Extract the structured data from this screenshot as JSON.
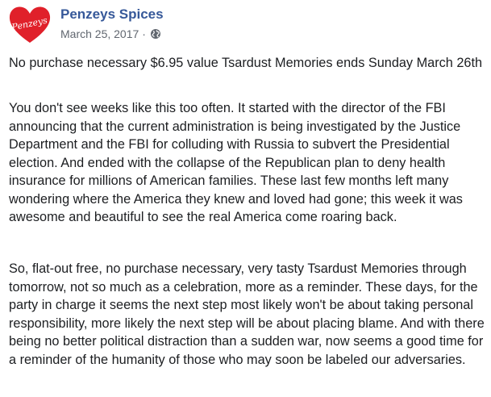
{
  "post": {
    "author": {
      "name": "Penzeys Spices",
      "avatar_text": "Penzeys",
      "avatar_color": "#e0202a"
    },
    "date": "March 25, 2017",
    "separator": "·",
    "privacy_icon": "globe-icon",
    "paragraphs": [
      "No purchase necessary $6.95 value Tsardust Memories ends Sunday March 26th",
      "You don't see weeks like this too often. It started with the director of the FBI announcing that the current administration is being investigated by the Justice Department and the FBI for colluding with Russia to subvert the Presidential election. And ended with the collapse of the Republican plan to deny health insurance for millions of American families. These last few months left many wondering where the America they knew and loved had gone; this week it was awesome and beautiful to see the real America come roaring back.",
      "So, flat-out free, no purchase necessary, very tasty Tsardust Memories through tomorrow, not so much as a celebration, more as a reminder. These days, for the party in charge it seems the next step most likely won't be about taking personal responsibility, more likely the next step will be about placing blame. And with there being no better political distraction than a sudden war, now seems a good time for a reminder of the humanity of those who may soon be labeled our adversaries."
    ]
  },
  "colors": {
    "name_link": "#365899",
    "meta_text": "#616770",
    "body_text": "#1c1e21"
  }
}
